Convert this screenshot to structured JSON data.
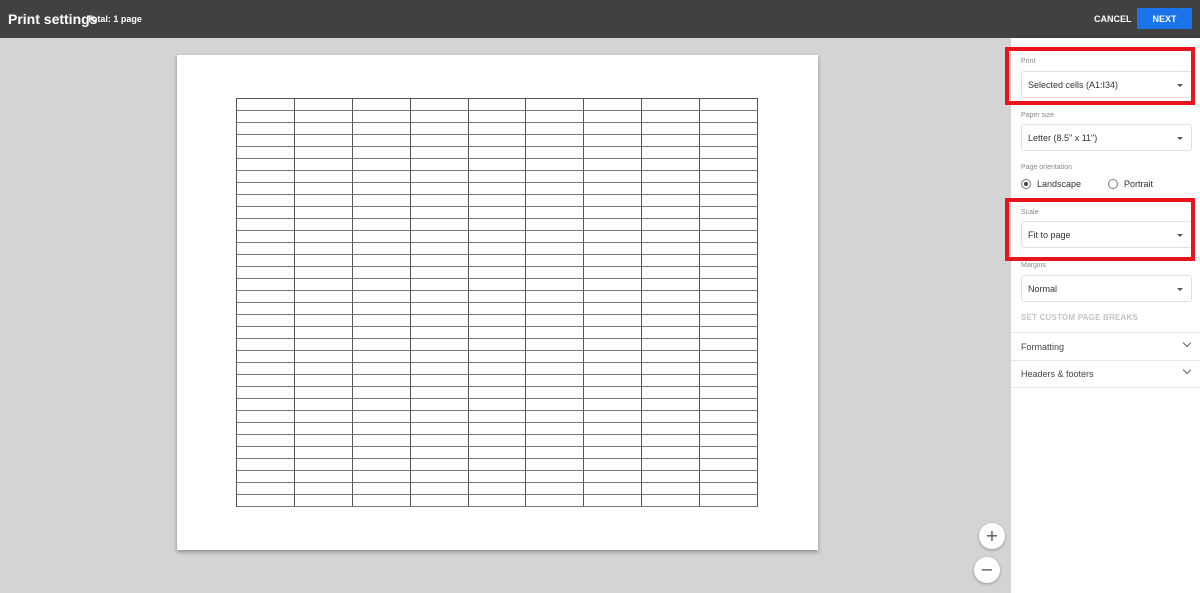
{
  "header": {
    "title": "Print settings",
    "total": "Total: 1 page",
    "cancel_label": "CANCEL",
    "next_label": "NEXT",
    "accent_color": "#1a73e8"
  },
  "preview": {
    "selected_range": "A1:I34",
    "columns": 9,
    "rows": 34,
    "zoom_in_label": "+",
    "zoom_out_label": "−"
  },
  "panel": {
    "print": {
      "label": "Print",
      "value": "Selected cells (A1:I34)"
    },
    "paper_size": {
      "label": "Paper size",
      "value": "Letter (8.5\" x 11\")"
    },
    "orientation": {
      "label": "Page orientation",
      "options": [
        {
          "label": "Landscape",
          "selected": true
        },
        {
          "label": "Portrait",
          "selected": false
        }
      ]
    },
    "scale": {
      "label": "Scale",
      "value": "Fit to page"
    },
    "margins": {
      "label": "Margins",
      "value": "Normal"
    },
    "custom_breaks_label": "SET CUSTOM PAGE BREAKS",
    "sections": [
      {
        "label": "Formatting"
      },
      {
        "label": "Headers & footers"
      }
    ],
    "highlight_color": "#e8141c"
  }
}
